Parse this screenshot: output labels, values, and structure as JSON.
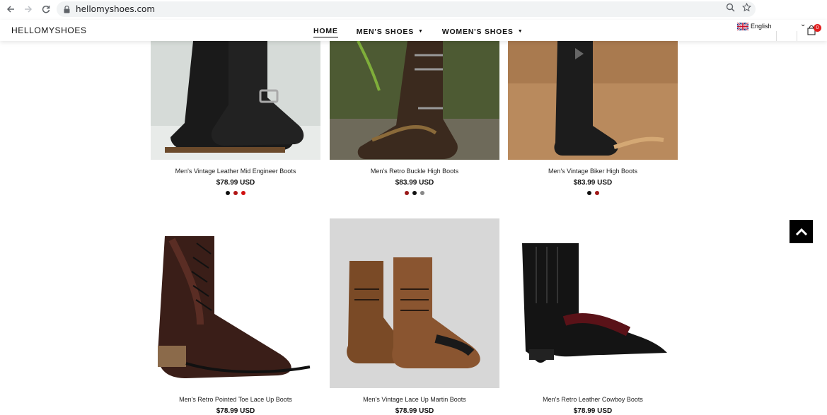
{
  "browser": {
    "url": "hellomyshoes.com",
    "back_icon": "arrow-left-icon",
    "forward_icon": "arrow-right-icon",
    "reload_icon": "reload-icon",
    "zoom_icon": "magnifier-icon",
    "bookmark_icon": "star-icon"
  },
  "header": {
    "logo": "HELLOMYSHOES",
    "menu": [
      {
        "label": "HOME",
        "active": true
      },
      {
        "label": "MEN'S SHOES",
        "has_dropdown": true
      },
      {
        "label": "WOMEN'S SHOES",
        "has_dropdown": true
      }
    ],
    "language": "English",
    "cart_count": "0"
  },
  "products": [
    {
      "name": "Men's Vintage Leather Mid Engineer Boots",
      "price": "$78.99 USD",
      "swatches": [
        "#111111",
        "#b01515",
        "#d01010"
      ]
    },
    {
      "name": "Men's Retro Buckle High Boots",
      "price": "$83.99 USD",
      "swatches": [
        "#9a1818",
        "#111111",
        "#888888"
      ]
    },
    {
      "name": "Men's Vintage Biker High Boots",
      "price": "$83.99 USD",
      "swatches": [
        "#111111",
        "#a01818"
      ]
    },
    {
      "name": "Men's Retro Pointed Toe Lace Up Boots",
      "price": "$78.99 USD",
      "swatches": []
    },
    {
      "name": "Men's Vintage Lace Up Martin Boots",
      "price": "$78.99 USD",
      "swatches": []
    },
    {
      "name": "Men's Retro Leather Cowboy Boots",
      "price": "$78.99 USD",
      "swatches": []
    }
  ],
  "colors": {
    "accent": "#000000",
    "badge": "#e02020"
  }
}
